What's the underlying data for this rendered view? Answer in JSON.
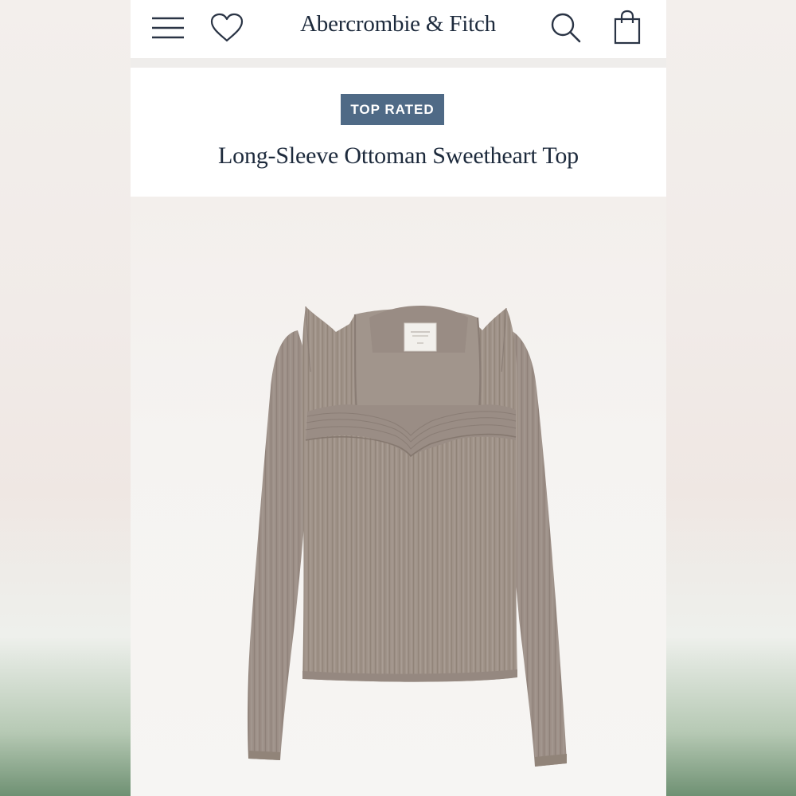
{
  "header": {
    "brand": "Abercrombie & Fitch",
    "menu_icon": "hamburger-menu-icon",
    "wishlist_icon": "heart-icon",
    "search_icon": "search-icon",
    "bag_icon": "shopping-bag-icon"
  },
  "product": {
    "badge": "TOP RATED",
    "title": "Long-Sleeve Ottoman Sweetheart Top",
    "image_subject": "taupe ribbed long-sleeve square-neck sweetheart top"
  },
  "colors": {
    "brand_navy": "#1d2a3c",
    "badge_bg": "#4f6a86",
    "sweater": "#9d9088"
  }
}
